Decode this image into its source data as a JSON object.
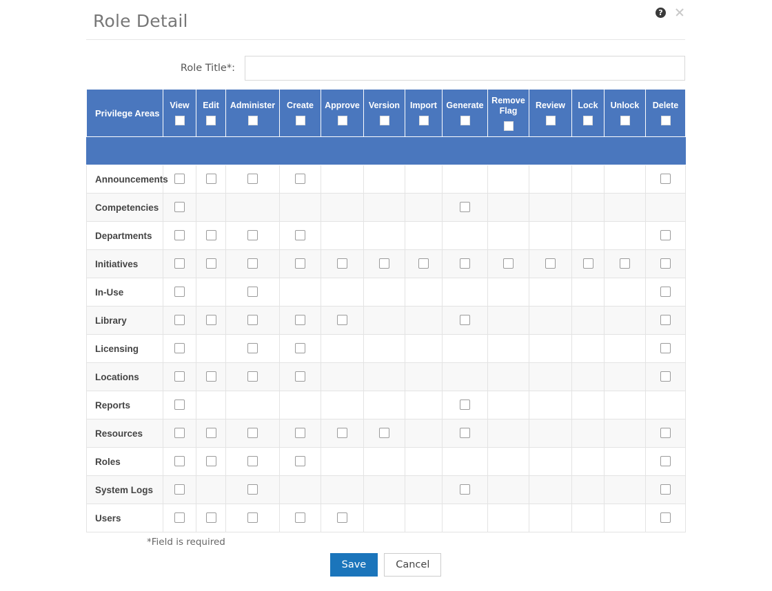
{
  "dialog": {
    "title": "Role Detail",
    "help_icon": "help-circle-icon",
    "close_icon": "close-icon"
  },
  "form": {
    "role_title_label": "Role Title*:",
    "role_title_value": "",
    "role_title_placeholder": ""
  },
  "table": {
    "row_header_label": "Privilege Areas",
    "columns": [
      "View",
      "Edit",
      "Administer",
      "Create",
      "Approve",
      "Version",
      "Import",
      "Generate",
      "Remove Flag",
      "Review",
      "Lock",
      "Unlock",
      "Delete"
    ],
    "rows": [
      {
        "label": "Announcements",
        "cells": [
          true,
          true,
          true,
          true,
          false,
          false,
          false,
          false,
          false,
          false,
          false,
          false,
          true
        ]
      },
      {
        "label": "Competencies",
        "cells": [
          true,
          false,
          false,
          false,
          false,
          false,
          false,
          true,
          false,
          false,
          false,
          false,
          false
        ]
      },
      {
        "label": "Departments",
        "cells": [
          true,
          true,
          true,
          true,
          false,
          false,
          false,
          false,
          false,
          false,
          false,
          false,
          true
        ]
      },
      {
        "label": "Initiatives",
        "cells": [
          true,
          true,
          true,
          true,
          true,
          true,
          true,
          true,
          true,
          true,
          true,
          true,
          true
        ]
      },
      {
        "label": "In-Use",
        "cells": [
          true,
          false,
          true,
          false,
          false,
          false,
          false,
          false,
          false,
          false,
          false,
          false,
          true
        ]
      },
      {
        "label": "Library",
        "cells": [
          true,
          true,
          true,
          true,
          true,
          false,
          false,
          true,
          false,
          false,
          false,
          false,
          true
        ]
      },
      {
        "label": "Licensing",
        "cells": [
          true,
          false,
          true,
          true,
          false,
          false,
          false,
          false,
          false,
          false,
          false,
          false,
          true
        ]
      },
      {
        "label": "Locations",
        "cells": [
          true,
          true,
          true,
          true,
          false,
          false,
          false,
          false,
          false,
          false,
          false,
          false,
          true
        ]
      },
      {
        "label": "Reports",
        "cells": [
          true,
          false,
          false,
          false,
          false,
          false,
          false,
          true,
          false,
          false,
          false,
          false,
          false
        ]
      },
      {
        "label": "Resources",
        "cells": [
          true,
          true,
          true,
          true,
          true,
          true,
          false,
          true,
          false,
          false,
          false,
          false,
          true
        ]
      },
      {
        "label": "Roles",
        "cells": [
          true,
          true,
          true,
          true,
          false,
          false,
          false,
          false,
          false,
          false,
          false,
          false,
          true
        ]
      },
      {
        "label": "System Logs",
        "cells": [
          true,
          false,
          true,
          false,
          false,
          false,
          false,
          true,
          false,
          false,
          false,
          false,
          true
        ]
      },
      {
        "label": "Users",
        "cells": [
          true,
          true,
          true,
          true,
          true,
          false,
          false,
          false,
          false,
          false,
          false,
          false,
          true
        ]
      }
    ]
  },
  "footer": {
    "required_note": "*Field is required",
    "save_label": "Save",
    "cancel_label": "Cancel"
  },
  "colors": {
    "header_blue": "#4a77be",
    "primary_blue": "#1b75bb",
    "stripe_gray": "#f8f8f8",
    "border_gray": "#e9e9e9"
  }
}
